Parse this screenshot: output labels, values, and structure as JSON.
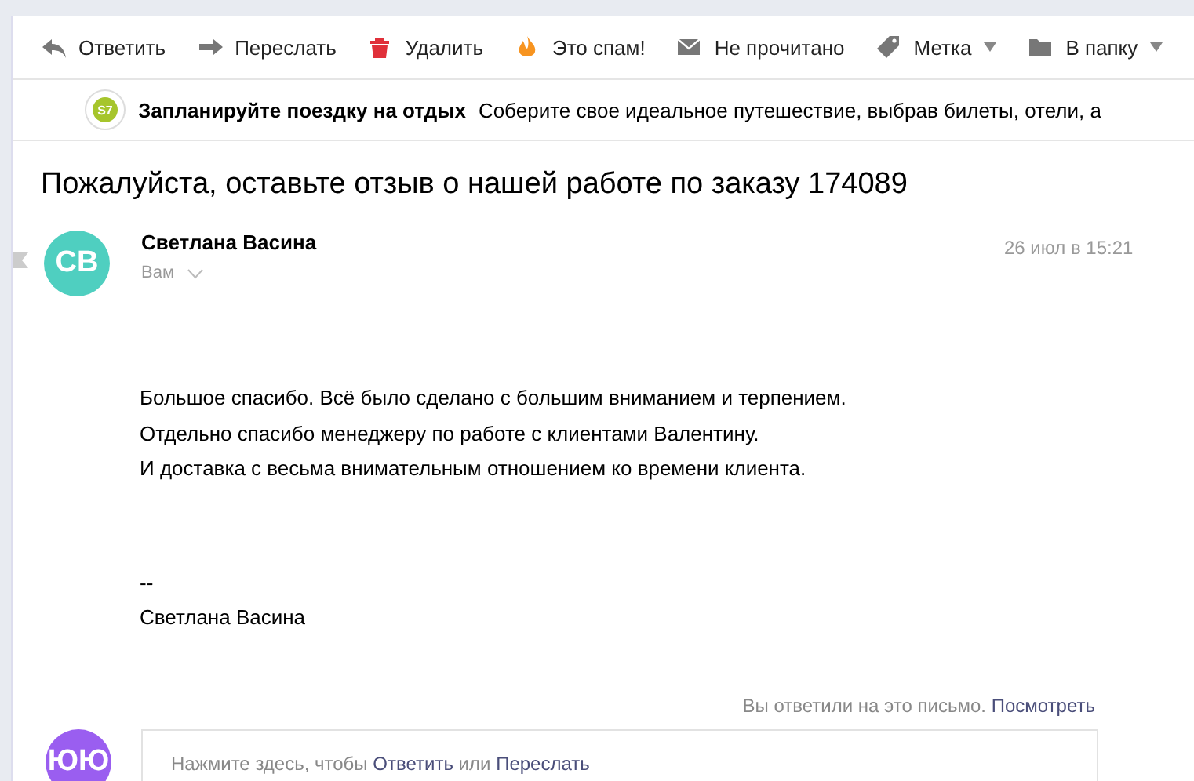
{
  "toolbar": [
    {
      "label": "Ответить",
      "kind": "reply",
      "dropdown": false
    },
    {
      "label": "Переслать",
      "kind": "forward",
      "dropdown": false
    },
    {
      "label": "Удалить",
      "kind": "trash",
      "dropdown": false
    },
    {
      "label": "Это спам!",
      "kind": "fire",
      "dropdown": false
    },
    {
      "label": "Не прочитано",
      "kind": "envelope",
      "dropdown": false
    },
    {
      "label": "Метка",
      "kind": "tag",
      "dropdown": true
    },
    {
      "label": "В папку",
      "kind": "folder",
      "dropdown": true
    }
  ],
  "ad": {
    "logo": "S7",
    "title": "Запланируйте поездку на отдых",
    "text": "Соберите свое идеальное путешествие, выбрав билеты, отели, а"
  },
  "message": {
    "subject": "Пожалуйста, оставьте отзыв о нашей работе по заказу 174089",
    "sender": {
      "initials": "СВ",
      "name": "Светлана Васина",
      "recipient": "Вам",
      "color": "#4fcfc0"
    },
    "date": "26 июл в 15:21",
    "body": [
      "Большое спасибо. Всё было сделано с большим вниманием и терпением.",
      "Отдельно спасибо менеджеру по работе с клиентами Валентину.",
      "И доставка с весьма внимательным отношением ко времени клиента."
    ],
    "signature": [
      "--",
      "Светлана Васина"
    ]
  },
  "replied_note": [
    {
      "text": "Вы ответили на это письмо.",
      "kind": "plain"
    },
    {
      "text": "Посмотреть",
      "kind": "link"
    }
  ],
  "reply_box": {
    "initials": "ЮЮ",
    "color": "#9a5ef0",
    "prompt": [
      {
        "text": "Нажмите здесь, чтобы",
        "kind": "plain"
      },
      {
        "text": "Ответить",
        "kind": "link"
      },
      {
        "text": "или",
        "kind": "plain"
      },
      {
        "text": "Переслать",
        "kind": "link"
      }
    ]
  }
}
